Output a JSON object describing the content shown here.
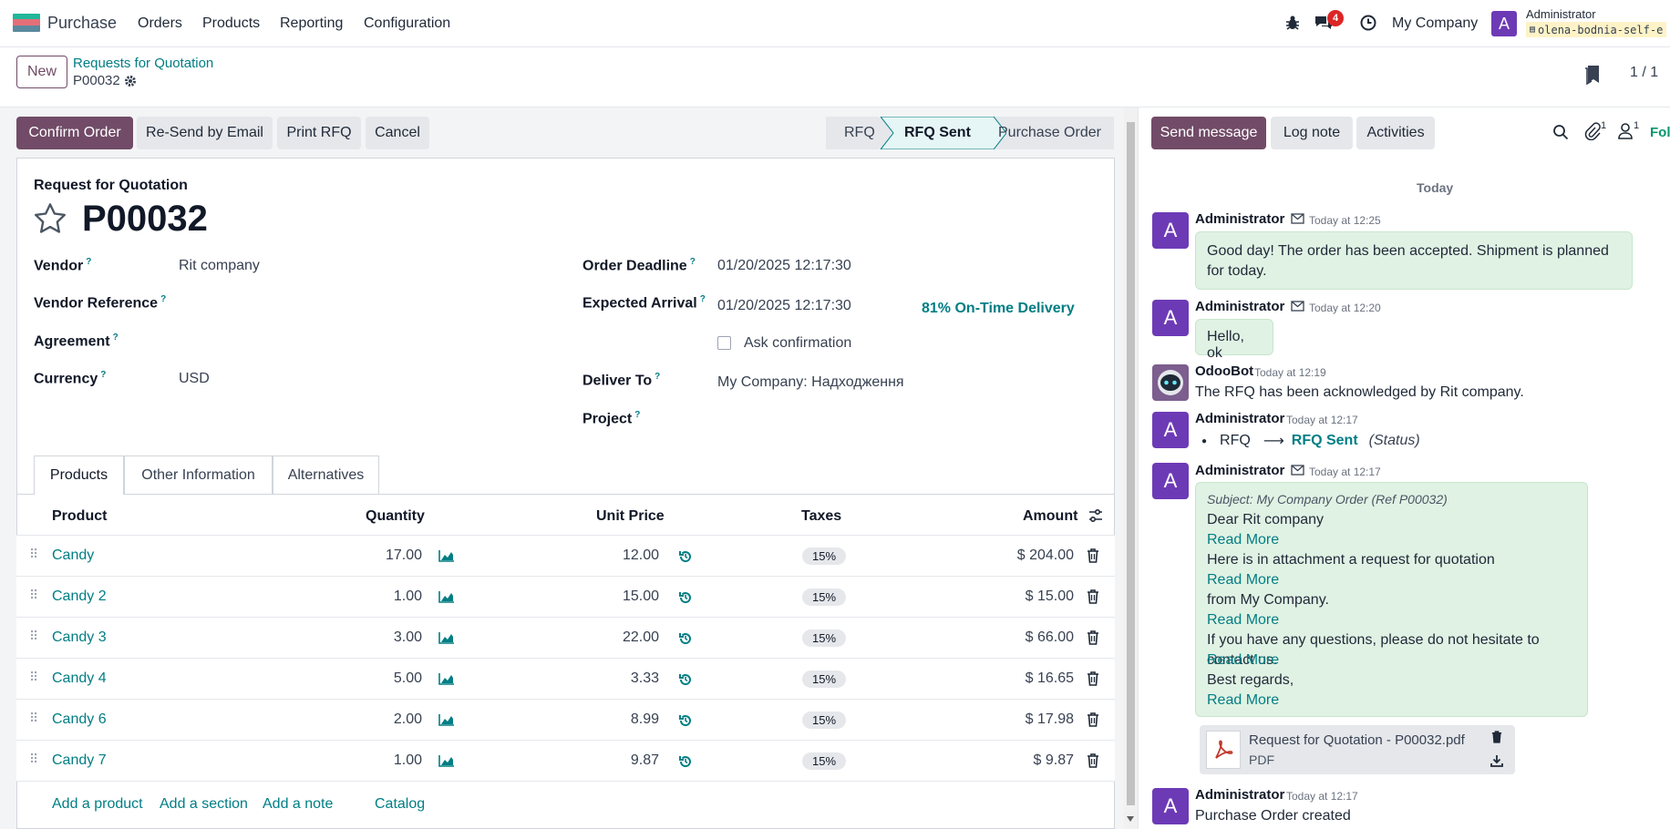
{
  "navbar": {
    "app_name": "Purchase",
    "menus": [
      "Orders",
      "Products",
      "Reporting",
      "Configuration"
    ],
    "message_count": "4",
    "company": "My Company",
    "user_initial": "A",
    "user_name": "Administrator",
    "db_name": "olena-bodnia-self-e"
  },
  "control": {
    "new_label": "New",
    "breadcrumb_parent": "Requests for Quotation",
    "record_name": "P00032",
    "pager": "1 / 1"
  },
  "actions": {
    "confirm": "Confirm Order",
    "resend": "Re-Send by Email",
    "print": "Print RFQ",
    "cancel": "Cancel"
  },
  "statusbar": {
    "steps": [
      "RFQ",
      "RFQ Sent",
      "Purchase Order"
    ],
    "active": "RFQ Sent"
  },
  "form": {
    "doc_type": "Request for Quotation",
    "title": "P00032",
    "vendor_label": "Vendor",
    "vendor": "Rit company",
    "vendor_ref_label": "Vendor Reference",
    "agreement_label": "Agreement",
    "currency_label": "Currency",
    "currency": "USD",
    "deadline_label": "Order Deadline",
    "deadline": "01/20/2025 12:17:30",
    "arrival_label": "Expected Arrival",
    "arrival": "01/20/2025 12:17:30",
    "on_time": "81% On-Time Delivery",
    "ask_confirmation": "Ask confirmation",
    "deliver_label": "Deliver To",
    "deliver": "My Company: Надходження",
    "project_label": "Project",
    "help_mark": "?"
  },
  "tabs": [
    "Products",
    "Other Information",
    "Alternatives"
  ],
  "table": {
    "headers": {
      "product": "Product",
      "quantity": "Quantity",
      "unit_price": "Unit Price",
      "taxes": "Taxes",
      "amount": "Amount"
    },
    "rows": [
      {
        "product": "Candy",
        "qty": "17.00",
        "price": "12.00",
        "tax": "15%",
        "amount": "$ 204.00"
      },
      {
        "product": "Candy 2",
        "qty": "1.00",
        "price": "15.00",
        "tax": "15%",
        "amount": "$ 15.00"
      },
      {
        "product": "Candy 3",
        "qty": "3.00",
        "price": "22.00",
        "tax": "15%",
        "amount": "$ 66.00"
      },
      {
        "product": "Candy 4",
        "qty": "5.00",
        "price": "3.33",
        "tax": "15%",
        "amount": "$ 16.65"
      },
      {
        "product": "Candy 6",
        "qty": "2.00",
        "price": "8.99",
        "tax": "15%",
        "amount": "$ 17.98"
      },
      {
        "product": "Candy 7",
        "qty": "1.00",
        "price": "9.87",
        "tax": "15%",
        "amount": "$ 9.87"
      }
    ],
    "add_product": "Add a product",
    "add_section": "Add a section",
    "add_note": "Add a note",
    "catalog": "Catalog"
  },
  "chatter": {
    "send_message": "Send message",
    "log_note": "Log note",
    "activities": "Activities",
    "attachments_count": "1",
    "followers_count": "1",
    "follow": "Fol",
    "day": "Today",
    "messages": [
      {
        "author": "Administrator",
        "time": "Today at 12:25",
        "text": "Good day! The order has been accepted. Shipment is planned for today."
      },
      {
        "author": "Administrator",
        "time": "Today at 12:20",
        "text": "Hello, ok"
      },
      {
        "author": "OdooBot",
        "time": "Today at 12:19",
        "text": "The RFQ has been acknowledged by Rit company."
      },
      {
        "author": "Administrator",
        "time": "Today at 12:17",
        "old": "RFQ",
        "new": "RFQ Sent",
        "field": "(Status)"
      },
      {
        "author": "Administrator",
        "time": "Today at 12:17",
        "subject": "Subject: My Company Order (Ref P00032)",
        "lines": [
          "Dear Rit company",
          "Here is in attachment a request for quotation",
          "from My Company.",
          "If you have any questions, please do not hesitate to contact us.",
          "Best regards,"
        ],
        "read_more": "Read More"
      },
      {
        "author": "Administrator",
        "time": "Today at 12:17",
        "text": "Purchase Order created"
      }
    ],
    "attachment": {
      "name": "Request for Quotation - P00032.pdf",
      "type": "PDF"
    }
  }
}
